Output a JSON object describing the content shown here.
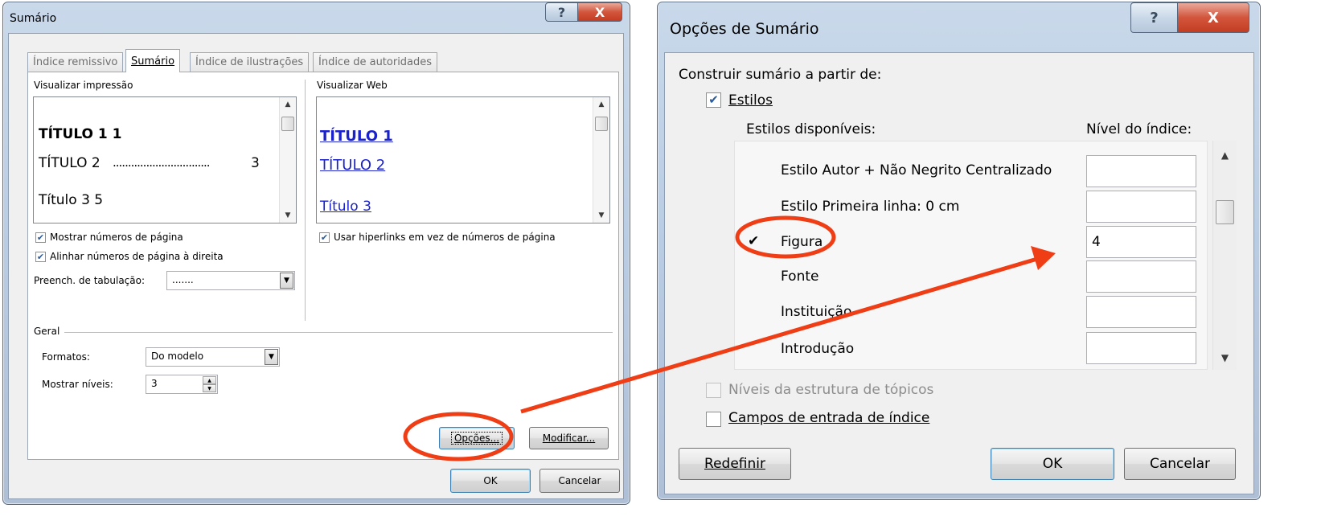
{
  "dialog_left": {
    "title": "Sumário",
    "help_glyph": "?",
    "close_glyph": "X",
    "tabs": [
      {
        "label": "Índice remissivo",
        "active": false
      },
      {
        "label": "Sumário",
        "active": true
      },
      {
        "label": "Índice de ilustrações",
        "active": false
      },
      {
        "label": "Índice de autoridades",
        "active": false
      }
    ],
    "print_preview": {
      "label": "Visualizar impressão",
      "lines": [
        "TÍTULO 1 1",
        "TÍTULO 2",
        "3",
        "Título 3 5"
      ],
      "leader_dots": "................................"
    },
    "web_preview": {
      "label": "Visualizar Web",
      "links": [
        "TÍTULO 1",
        "TÍTULO 2",
        "Título 3"
      ]
    },
    "show_page_numbers": {
      "label": "Mostrar números de página",
      "checked": true
    },
    "align_right": {
      "label": "Alinhar números de página à direita",
      "checked": true
    },
    "tab_leader": {
      "label": "Preench. de tabulação:",
      "value": "......."
    },
    "use_hyperlinks": {
      "label": "Usar hiperlinks em vez de números de página",
      "checked": true
    },
    "general": {
      "label": "Geral",
      "formats_label": "Formatos:",
      "formats_value": "Do modelo",
      "levels_label": "Mostrar níveis:",
      "levels_value": "3"
    },
    "options_button": "Opções...",
    "modify_button": "Modificar...",
    "ok_button": "OK",
    "cancel_button": "Cancelar"
  },
  "dialog_right": {
    "title": "Opções de Sumário",
    "help_glyph": "?",
    "close_glyph": "X",
    "build_from_label": "Construir sumário a partir de:",
    "styles_checkbox": {
      "label": "Estilos",
      "checked": true
    },
    "available_styles_header": "Estilos disponíveis:",
    "toc_level_header": "Nível do índice:",
    "styles": [
      {
        "name": "Estilo Autor + Não Negrito Centralizado",
        "level": "",
        "checked": false
      },
      {
        "name": "Estilo Primeira linha:  0 cm",
        "level": "",
        "checked": false
      },
      {
        "name": "Figura",
        "level": "4",
        "checked": true
      },
      {
        "name": "Fonte",
        "level": "",
        "checked": false
      },
      {
        "name": "Instituição",
        "level": "",
        "checked": false
      },
      {
        "name": "Introdução",
        "level": "",
        "checked": false
      }
    ],
    "check_glyph": "✔",
    "outline_levels": {
      "label": "Níveis da estrutura de tópicos",
      "checked": false,
      "disabled": true
    },
    "index_fields": {
      "label": "Campos de entrada de índice",
      "checked": false
    },
    "reset_button": "Redefinir",
    "ok_button": "OK",
    "cancel_button": "Cancelar"
  },
  "annotations": {
    "color": "#ef3d16"
  }
}
